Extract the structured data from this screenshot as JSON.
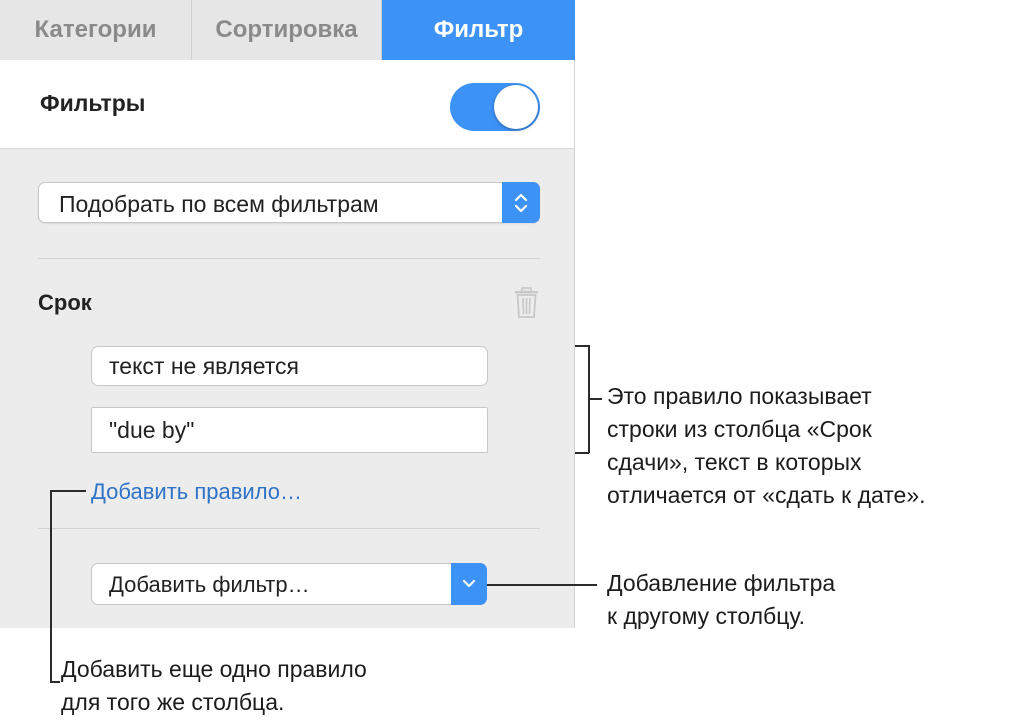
{
  "tabs": [
    {
      "label": "Категории",
      "active": false
    },
    {
      "label": "Сортировка",
      "active": false
    },
    {
      "label": "Фильтр",
      "active": true
    }
  ],
  "filters": {
    "title": "Фильтры",
    "enabled": true
  },
  "match_select": {
    "value": "Подобрать по всем фильтрам"
  },
  "rule": {
    "column": "Срок",
    "condition": "текст не является",
    "value": "\"due by\""
  },
  "add_rule_link": "Добавить правило…",
  "add_filter": {
    "label": "Добавить фильтр…"
  },
  "callouts": {
    "rule_lines": [
      "Это правило показывает",
      "строки из столбца «Срок",
      "сдачи», текст в которых",
      "отличается от «сдать к дате»."
    ],
    "add_filter_lines": [
      "Добавление фильтра",
      "к другому столбцу."
    ],
    "add_rule_lines": [
      "Добавить еще одно правило",
      "для того же столбца."
    ]
  },
  "colors": {
    "accent": "#3d92f5",
    "link": "#2e73c7",
    "panel_bg": "#ececec"
  },
  "icons": {
    "stepper": "up-down-chevron-icon",
    "trash": "trash-icon",
    "dropdown": "chevron-down-icon"
  }
}
